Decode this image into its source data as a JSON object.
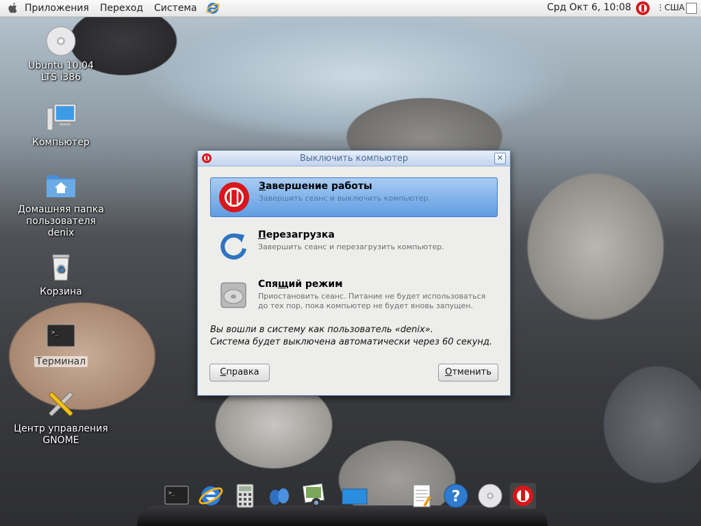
{
  "top_panel": {
    "menus": [
      "Приложения",
      "Переход",
      "Система"
    ],
    "clock": "Срд Окт  6, 10:08",
    "keyboard_layout": "США"
  },
  "desktop_icons": [
    {
      "label": "Ubuntu 10.04 LTS i386",
      "icon": "cd-icon"
    },
    {
      "label": "Компьютер",
      "icon": "computer-icon"
    },
    {
      "label": "Домашняя папка пользователя denix",
      "icon": "home-folder-icon"
    },
    {
      "label": "Корзина",
      "icon": "trash-icon"
    },
    {
      "label": "Терминал",
      "icon": "terminal-icon"
    },
    {
      "label": "Центр управления GNOME",
      "icon": "control-center-icon"
    }
  ],
  "dialog": {
    "title": "Выключить компьютер",
    "options": [
      {
        "title": "Завершение работы",
        "mnemonic": "З",
        "rest": "авершение работы",
        "desc": "Завершить сеанс и выключить компьютер.",
        "selected": true
      },
      {
        "title": "Перезагрузка",
        "mnemonic": "П",
        "rest": "ерезагрузка",
        "desc": "Завершить сеанс и перезагрузить компьютер.",
        "selected": false
      },
      {
        "title": "Спящий режим",
        "pre": "Спя",
        "mnemonic": "щ",
        "rest": "ий режим",
        "desc": "Приостановить сеанс. Питание не будет использоваться до тех пор, пока компьютер не будет вновь запущен.",
        "selected": false
      }
    ],
    "info_line1": "Вы вошли в систему как пользователь «denix».",
    "info_line2": "Система будет выключена автоматически через 60 секунд.",
    "help_button": {
      "mnemonic": "С",
      "rest": "правка"
    },
    "cancel_button": {
      "mnemonic": "О",
      "rest": "тменить"
    }
  },
  "dock_items": [
    "terminal-icon",
    "internet-explorer-icon",
    "calculator-icon",
    "messenger-icon",
    "photo-viewer-icon",
    "desktop-icon",
    "text-editor-icon",
    "help-icon",
    "cd-icon",
    "shutdown-icon"
  ],
  "colors": {
    "accent": "#5f9de1",
    "power_red": "#d8161b"
  }
}
